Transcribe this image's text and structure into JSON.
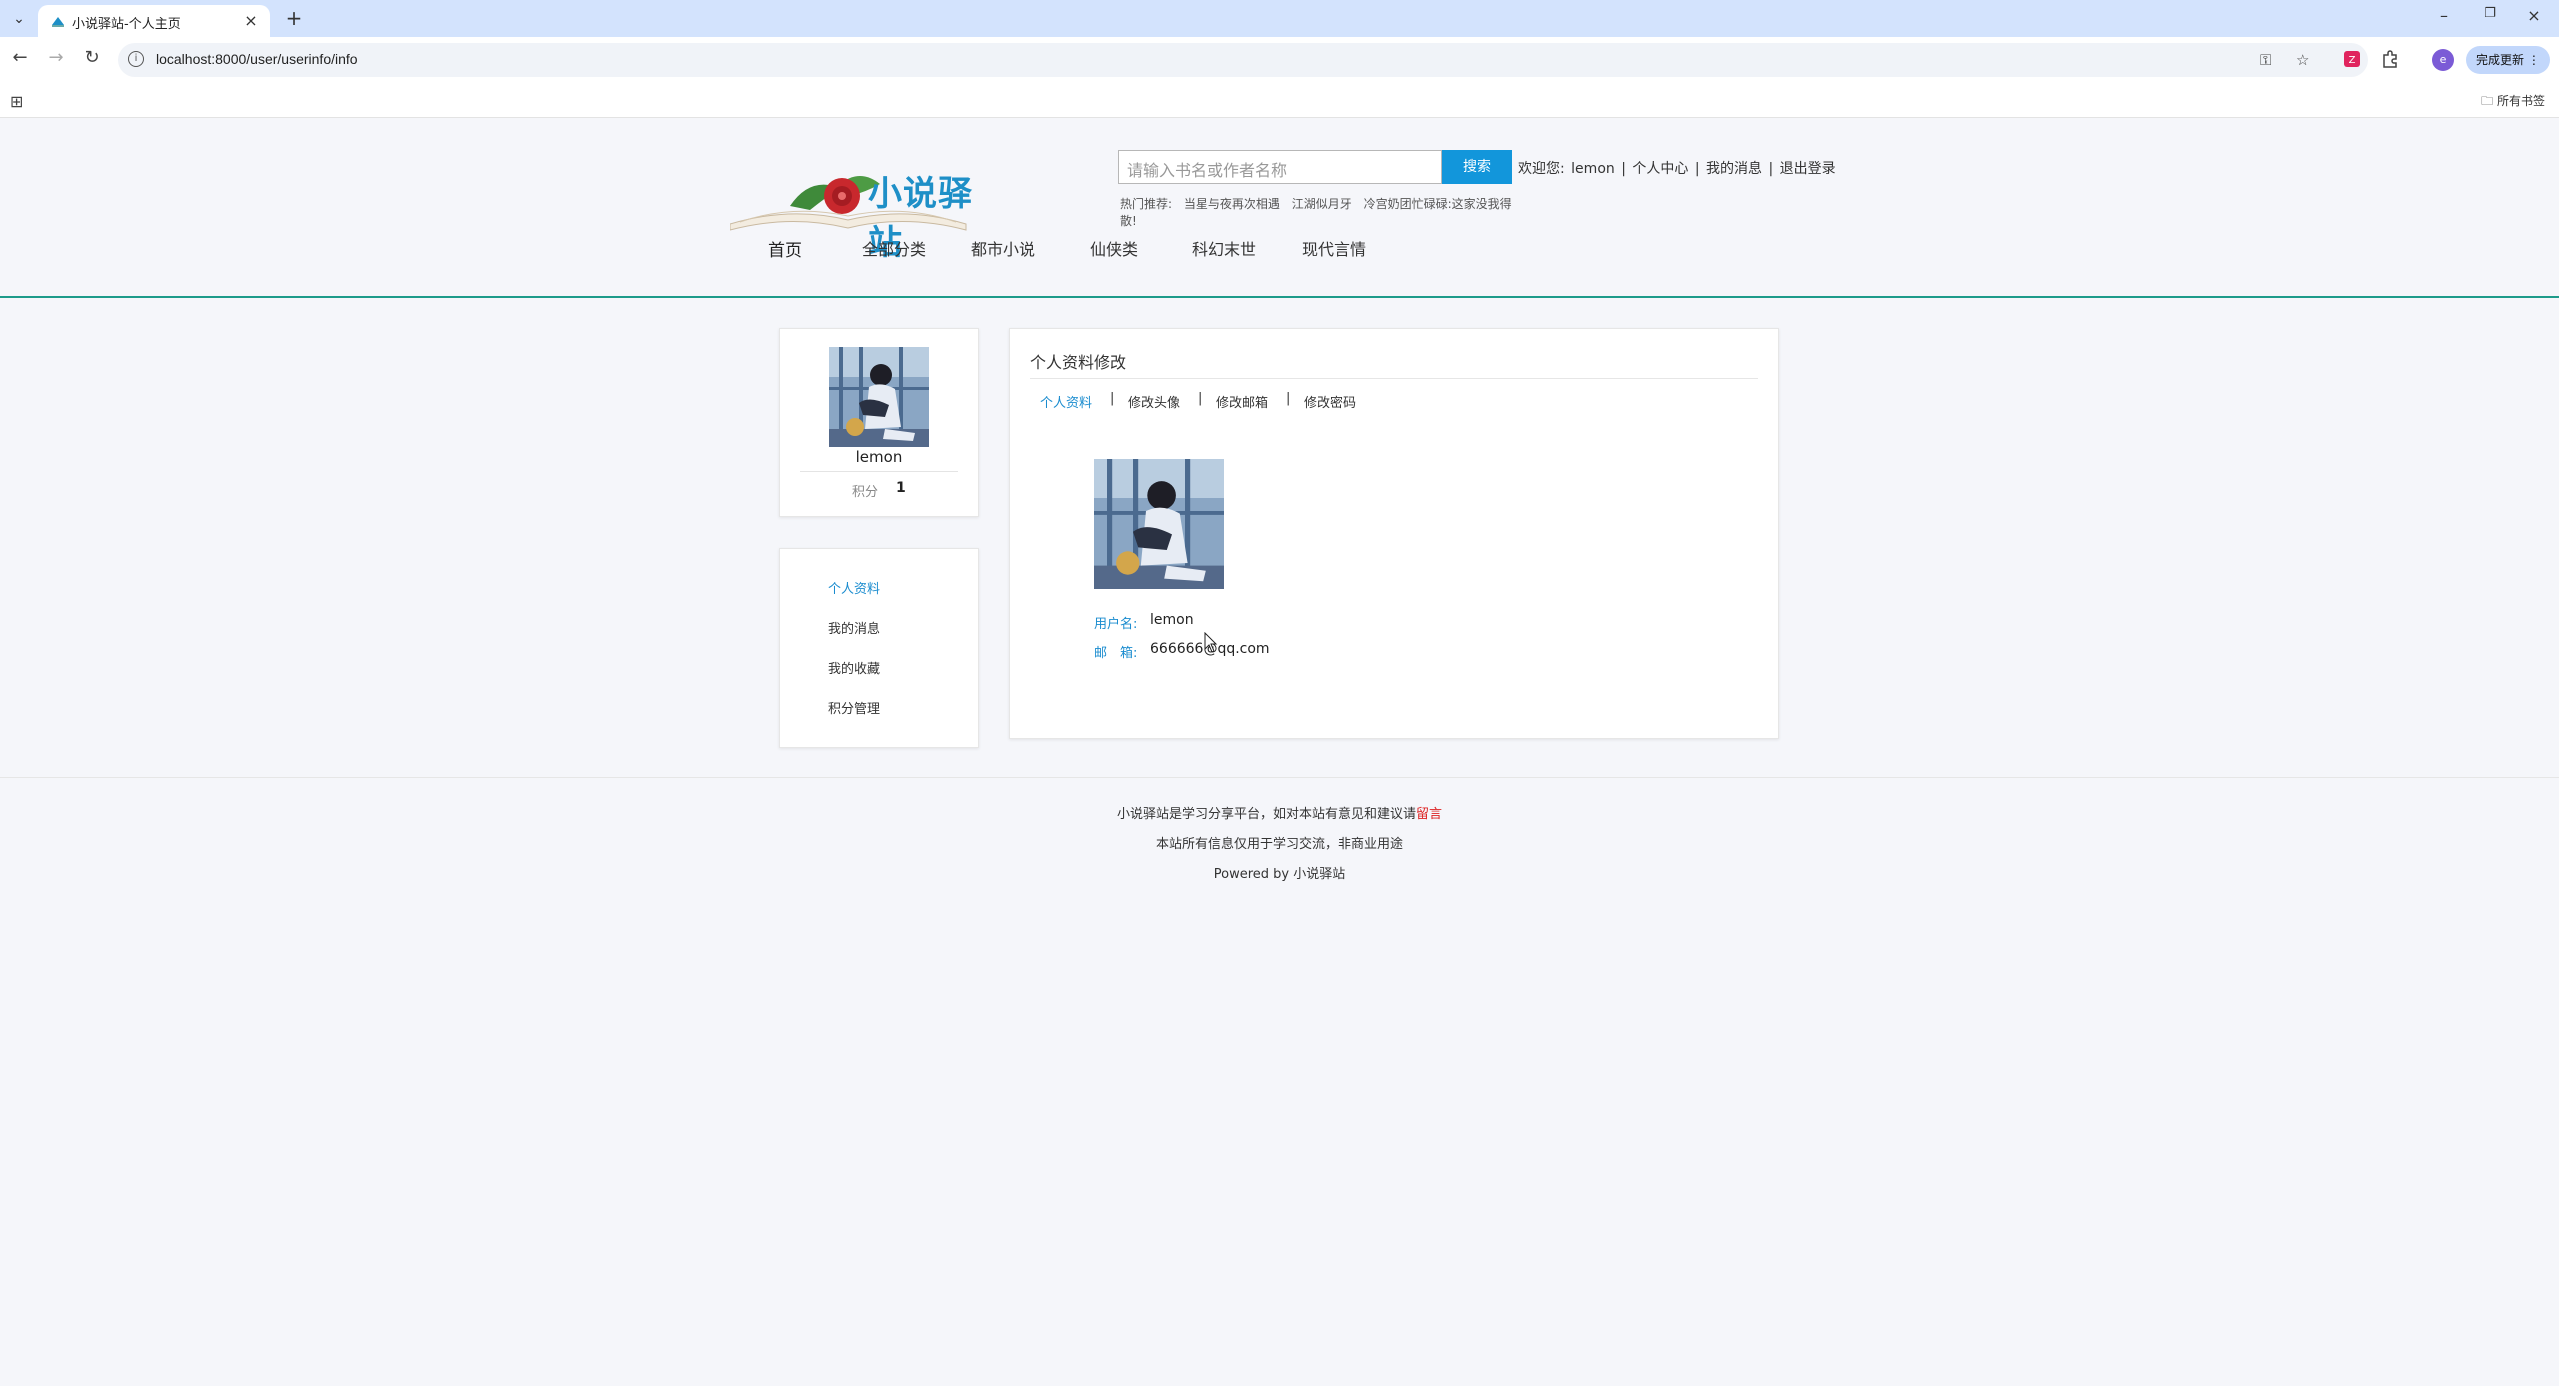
{
  "browser": {
    "tab_title": "小说驿站-个人主页",
    "url": "localhost:8000/user/userinfo/info",
    "update_label": "完成更新",
    "all_bookmarks_label": "所有书签",
    "profile_initial": "e"
  },
  "header": {
    "logo_text": "小说驿站",
    "search_placeholder": "请输入书名或作者名称",
    "search_button": "搜索",
    "welcome": "欢迎您:",
    "username": "lemon",
    "sep": "|",
    "user_center": "个人中心",
    "my_messages": "我的消息",
    "logout": "退出登录",
    "hot_label": "热门推荐:",
    "hot_items": [
      "当星与夜再次相遇",
      "江湖似月牙",
      "冷宫奶团忙碌碌:这家没我得散!"
    ]
  },
  "nav": {
    "items": [
      "首页",
      "全部分类",
      "都市小说",
      "仙侠类",
      "科幻末世",
      "现代言情"
    ]
  },
  "sidebar": {
    "username": "lemon",
    "score_label": "积分",
    "score_value": "1",
    "menu": [
      "个人资料",
      "我的消息",
      "我的收藏",
      "积分管理"
    ]
  },
  "panel": {
    "title": "个人资料修改",
    "tabs": [
      "个人资料",
      "修改头像",
      "修改邮箱",
      "修改密码"
    ],
    "username_label": "用户名:",
    "username_value": "lemon",
    "email_label": "邮　箱:",
    "email_value": "666666@qq.com"
  },
  "footer": {
    "line1_prefix": "小说驿站是学习分享平台，如对本站有意见和建议请",
    "line1_link": "留言",
    "line2": "本站所有信息仅用于学习交流，非商业用途",
    "line3": "Powered by 小说驿站"
  }
}
